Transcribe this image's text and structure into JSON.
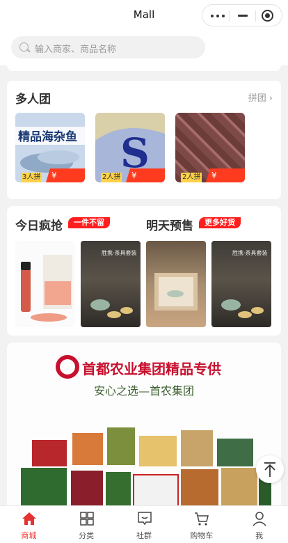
{
  "app": {
    "title": "Mall"
  },
  "search": {
    "placeholder": "输入商家、商品名称"
  },
  "group_buy": {
    "title": "多人团",
    "more_label": "拼团",
    "more_arrow": "›",
    "items": [
      {
        "count": "3人拼",
        "price": "¥ 19.00",
        "image_text": "精品海杂鱼"
      },
      {
        "count": "2人拼",
        "price": "¥ 17.90",
        "image_text": "S"
      },
      {
        "count": "2人拼",
        "price": "¥ 118.00",
        "image_text": ""
      }
    ]
  },
  "flash": {
    "left_title": "今日疯抢",
    "left_badge": "一件不留",
    "right_title": "明天预售",
    "right_badge": "更多好货",
    "items": [
      {
        "image_text": ""
      },
      {
        "image_text": "胜携·茶具套装"
      },
      {
        "image_text": ""
      },
      {
        "image_text": "胜携·茶具套装"
      }
    ]
  },
  "banner": {
    "company": "首都农业集团",
    "highlight": "精品专供",
    "slogan": "安心之选—首农集团"
  },
  "tabbar": {
    "items": [
      {
        "label": "商城",
        "icon": "home-icon",
        "active": true
      },
      {
        "label": "分类",
        "icon": "grid-icon",
        "active": false
      },
      {
        "label": "社群",
        "icon": "chat-icon",
        "active": false
      },
      {
        "label": "购物车",
        "icon": "cart-icon",
        "active": false
      },
      {
        "label": "我",
        "icon": "user-icon",
        "active": false
      }
    ]
  },
  "colors": {
    "accent": "#e33333",
    "price_bg": "#ff3b1f",
    "count_bg": "#ffd24a",
    "brand_red": "#c8102e"
  }
}
